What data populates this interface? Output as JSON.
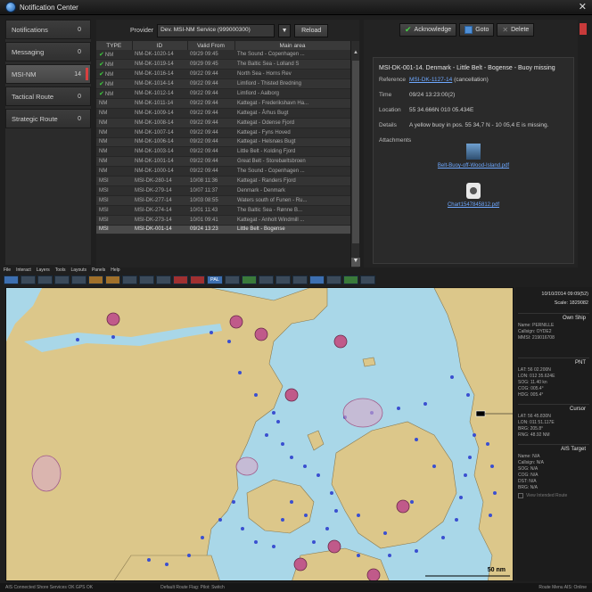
{
  "window": {
    "title": "Notification Center"
  },
  "nav": [
    {
      "label": "Notifications",
      "count": "0",
      "active": false
    },
    {
      "label": "Messaging",
      "count": "0",
      "active": false
    },
    {
      "label": "MSI-NM",
      "count": "14",
      "active": true
    },
    {
      "label": "Tactical Route",
      "count": "0",
      "active": false
    },
    {
      "label": "Strategic Route",
      "count": "0",
      "active": false
    }
  ],
  "provider": {
    "label": "Provider",
    "value": "Dev. MSI-NM Service (999000300)",
    "reload_label": "Reload"
  },
  "table": {
    "columns": [
      "TYPE",
      "ID",
      "Valid From",
      "Main area"
    ],
    "rows": [
      {
        "check": true,
        "type": "NM",
        "id": "NM-DK-1020-14",
        "valid": "09/29 09:45",
        "area": "The Sound - Copenhagen ..."
      },
      {
        "check": true,
        "type": "NM",
        "id": "NM-DK-1019-14",
        "valid": "09/29 09:45",
        "area": "The Baltic Sea - Lolland S"
      },
      {
        "check": true,
        "type": "NM",
        "id": "NM-DK-1016-14",
        "valid": "09/22 09:44",
        "area": "North Sea - Horns Rev"
      },
      {
        "check": true,
        "type": "NM",
        "id": "NM-DK-1014-14",
        "valid": "09/22 09:44",
        "area": "Limfiord - Thisted Bredning"
      },
      {
        "check": true,
        "type": "NM",
        "id": "NM-DK-1012-14",
        "valid": "09/22 09:44",
        "area": "Limfiord - Aalborg"
      },
      {
        "check": false,
        "type": "NM",
        "id": "NM-DK-1011-14",
        "valid": "09/22 09:44",
        "area": "Kattegat - Frederikshavn Ha..."
      },
      {
        "check": false,
        "type": "NM",
        "id": "NM-DK-1009-14",
        "valid": "09/22 09:44",
        "area": "Kattegat - Århus Bugt"
      },
      {
        "check": false,
        "type": "NM",
        "id": "NM-DK-1008-14",
        "valid": "09/22 09:44",
        "area": "Kattegat - Odense Fjord"
      },
      {
        "check": false,
        "type": "NM",
        "id": "NM-DK-1007-14",
        "valid": "09/22 09:44",
        "area": "Kattegat - Fyns Hoved"
      },
      {
        "check": false,
        "type": "NM",
        "id": "NM-DK-1006-14",
        "valid": "09/22 09:44",
        "area": "Kattegat - Helsnæs Bugt"
      },
      {
        "check": false,
        "type": "NM",
        "id": "NM-DK-1003-14",
        "valid": "09/22 09:44",
        "area": "Little Belt - Kolding Fjord"
      },
      {
        "check": false,
        "type": "NM",
        "id": "NM-DK-1001-14",
        "valid": "09/22 09:44",
        "area": "Great Belt - Storebæltsbroen"
      },
      {
        "check": false,
        "type": "NM",
        "id": "NM-DK-1000-14",
        "valid": "09/22 09:44",
        "area": "The Sound - Copenhagen ..."
      },
      {
        "check": false,
        "type": "MSI",
        "id": "MSI-DK-280-14",
        "valid": "10/08 11:36",
        "area": "Kattegat - Randers Fjord"
      },
      {
        "check": false,
        "type": "MSI",
        "id": "MSI-DK-279-14",
        "valid": "10/07 11:37",
        "area": "Denmark - Denmark"
      },
      {
        "check": false,
        "type": "MSI",
        "id": "MSI-DK-277-14",
        "valid": "10/03 08:55",
        "area": "Waters south of Funen - Ru..."
      },
      {
        "check": false,
        "type": "MSI",
        "id": "MSI-DK-274-14",
        "valid": "10/01 11:43",
        "area": "The Baltic Sea - Rønne B..."
      },
      {
        "check": false,
        "type": "MSI",
        "id": "MSI-DK-273-14",
        "valid": "10/01 09:41",
        "area": "Kattegat - Anholt Windmill ..."
      },
      {
        "check": false,
        "type": "MSI",
        "id": "MSI-DK-001-14",
        "valid": "09/24 13:23",
        "area": "Little Belt - Bogense",
        "selected": true
      }
    ]
  },
  "actions": {
    "acknowledge": "Acknowledge",
    "goto": "Goto",
    "delete": "Delete"
  },
  "detail": {
    "heading": "MSI-DK-001-14. Denmark - Little Belt - Bogense - Buoy missing",
    "reference_label": "Reference",
    "reference_link": "MSI-DK-1127-14",
    "reference_suffix": "(cancellation)",
    "time_label": "Time",
    "time_value": "09/24 13:23:00(2)",
    "location_label": "Location",
    "location_value": "55 34.666N 010 05.434E",
    "details_label": "Details",
    "details_value": "A yellow buoy in pos. 55 34,7 N - 10 05,4 E is missing.",
    "attachments_label": "Attachments",
    "attachment1": "Belt-Buoy-off-Wood-Island.pdf",
    "attachment2": "Chart1547845812.pdf"
  },
  "menu": [
    "File",
    "Interact",
    "Layers",
    "Tools",
    "Layouts",
    "Panels",
    "Help"
  ],
  "toolbar": {
    "pal_label": "PAL"
  },
  "map": {
    "scale_label": "50 nm"
  },
  "info": {
    "datetime": "10/10/2014 09:09(52)",
    "scale": "Scale: 1829082",
    "own_ship": {
      "title": "Own Ship",
      "lines": [
        "Name: PERNILLE",
        "Callsign: OYDE2",
        "MMSI: 219016708"
      ]
    },
    "pnt": {
      "title": "PNT",
      "lines": [
        "LAT: 56 02.200N",
        "LON: 012 35.624E",
        "SOG: 11.40 kn",
        "COG: 005.4°",
        "HDG: 005.4°"
      ]
    },
    "cursor": {
      "title": "Cursor",
      "lines": [
        "LAT: 56 45.830N",
        "LON: 011 51.117E",
        "BRG: 205.8°",
        "RNG: 48.92 NM"
      ]
    },
    "ais_target": {
      "title": "AIS Target",
      "lines": [
        "Name: N/A",
        "Callsign: N/A",
        "SOG: N/A",
        "COG: N/A",
        "DST: N/A",
        "BRG: N/A"
      ],
      "view_label": "View Intended Route"
    }
  },
  "status": {
    "left": "AIS Connected  Shore Services OK  GPS OK",
    "mid": "Default Route Flag: Pilot: Switch",
    "right": "Route Menu  AIS: Online"
  }
}
